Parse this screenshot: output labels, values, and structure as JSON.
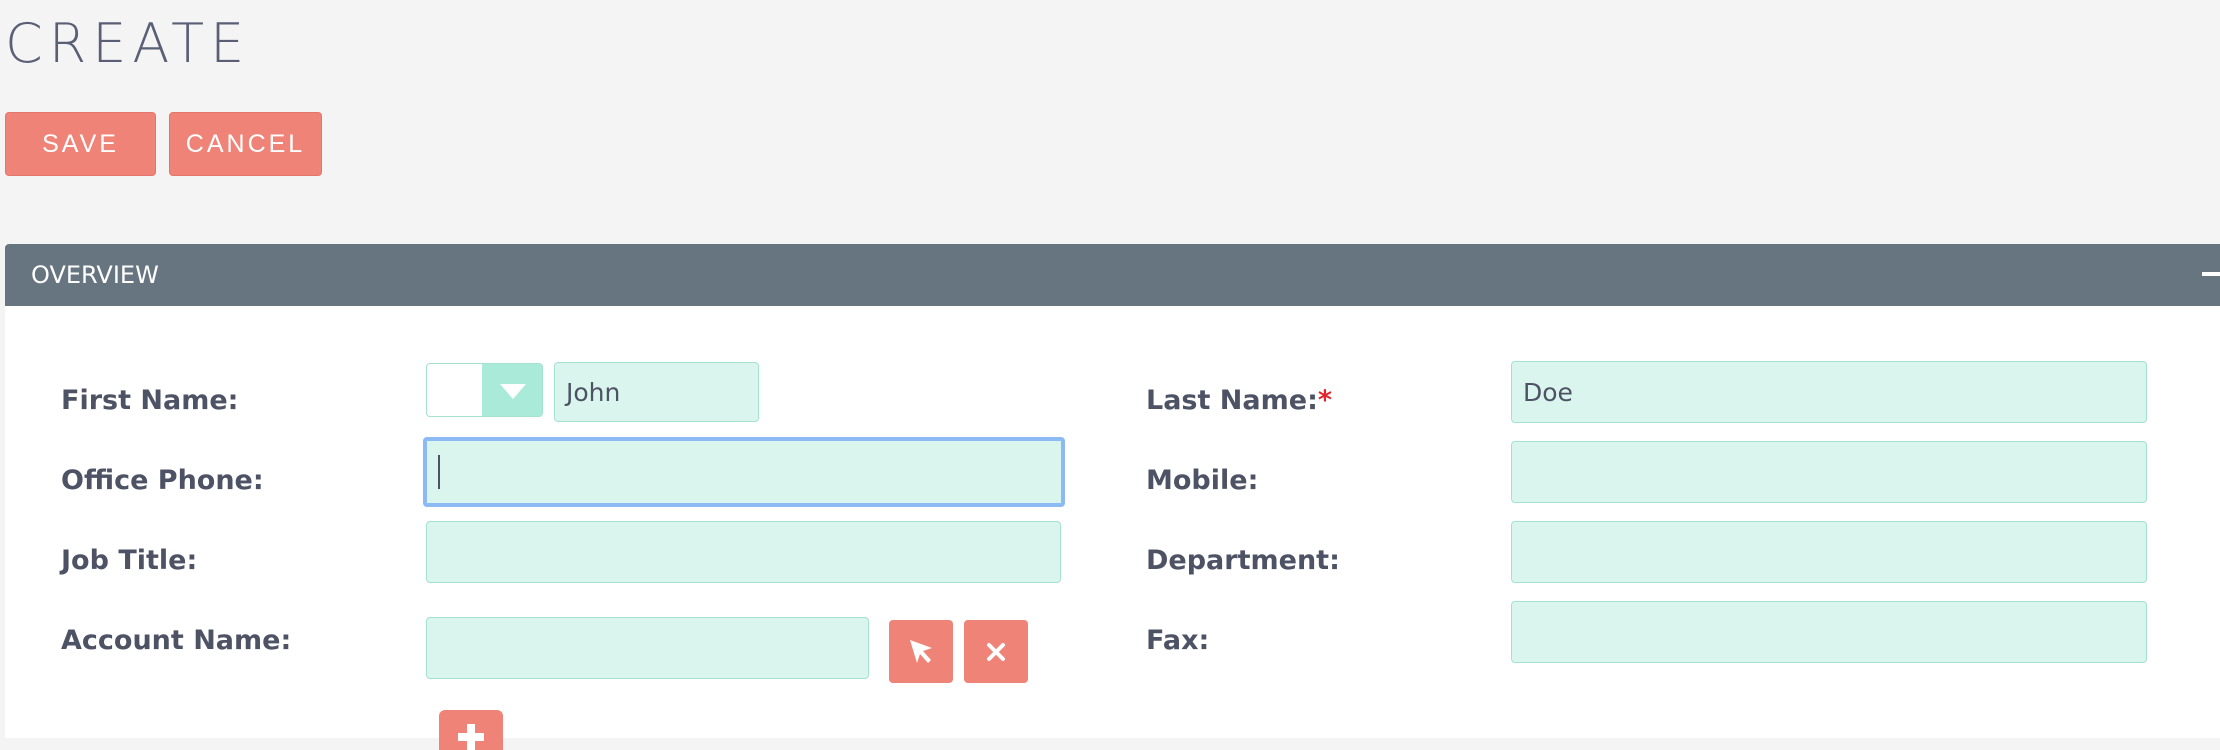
{
  "page": {
    "title": "CREATE"
  },
  "actions": {
    "save_label": "SAVE",
    "cancel_label": "CANCEL"
  },
  "panel": {
    "title": "OVERVIEW",
    "collapse_icon": "minus-icon"
  },
  "form": {
    "first_name": {
      "label": "First Name:",
      "salutation_value": "",
      "value": "John"
    },
    "last_name": {
      "label": "Last Name:",
      "required_marker": "*",
      "value": "Doe"
    },
    "office_phone": {
      "label": "Office Phone:",
      "value": ""
    },
    "mobile": {
      "label": "Mobile:",
      "value": ""
    },
    "job_title": {
      "label": "Job Title:",
      "value": ""
    },
    "department": {
      "label": "Department:",
      "value": ""
    },
    "account_name": {
      "label": "Account Name:",
      "value": "",
      "select_icon": "cursor-arrow-icon",
      "clear_icon": "close-icon"
    },
    "fax": {
      "label": "Fax:",
      "value": ""
    },
    "add_icon": "plus-icon"
  },
  "colors": {
    "background": "#f4f4f4",
    "accent_button": "#f08377",
    "panel_header": "#677580",
    "field_background": "#daf5ed",
    "field_border": "#a4e2cf",
    "focus_border": "#8bbaf4",
    "required": "#e0262c",
    "label_text": "#4d5264"
  }
}
